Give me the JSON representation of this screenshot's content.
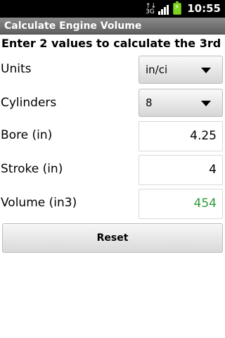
{
  "status_bar": {
    "time": "10:55"
  },
  "app": {
    "title": "Calculate Engine Volume"
  },
  "instruction": "Enter 2 values to calculate the 3rd",
  "units": {
    "label": "Units",
    "selected": "in/ci"
  },
  "cylinders": {
    "label": "Cylinders",
    "selected": "8"
  },
  "bore": {
    "label": "Bore (in)",
    "value": "4.25"
  },
  "stroke": {
    "label": "Stroke (in)",
    "value": "4"
  },
  "volume": {
    "label": "Volume (in3)",
    "value": "454"
  },
  "buttons": {
    "reset": "Reset"
  },
  "colors": {
    "result_green": "#2e9b3b",
    "status_bar": "#000000",
    "battery": "#7ed321"
  }
}
